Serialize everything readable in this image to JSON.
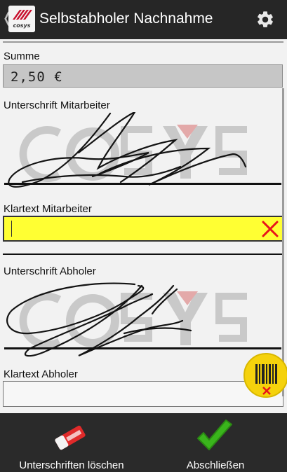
{
  "header": {
    "title": "Selbstabholer Nachnahme",
    "back_glyph": "❬",
    "logo_icon": "cosys-logo-icon",
    "settings_icon": "gear-icon"
  },
  "form": {
    "sum_label": "Summe",
    "sum_value": "2,50 €",
    "employee_signature_label": "Unterschrift Mitarbeiter",
    "employee_name_label": "Klartext Mitarbeiter",
    "employee_name_value": "",
    "pickup_signature_label": "Unterschrift Abholer",
    "pickup_name_label": "Klartext Abholer",
    "pickup_name_value": ""
  },
  "watermark": "COSYS",
  "actions": {
    "clear_signatures": "Unterschriften löschen",
    "finish": "Abschließen"
  },
  "colors": {
    "highlight_field": "#ffff33",
    "clear_x": "#e8141a",
    "check_green": "#3ab51c",
    "fab_yellow": "#f5d20c"
  }
}
